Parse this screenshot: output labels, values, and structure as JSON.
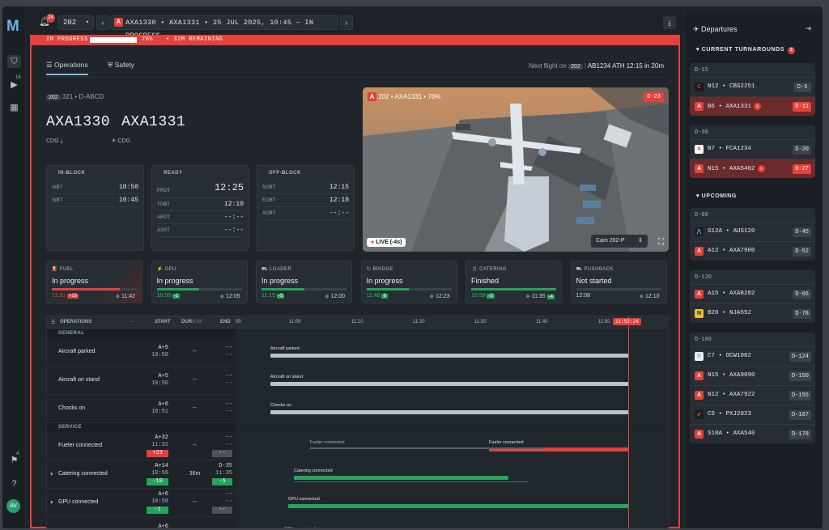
{
  "app": {
    "logo": "M",
    "rail_badge_camera": "16",
    "rail_badge_flag": "4",
    "avatar": "AV"
  },
  "topbar": {
    "bell_badge": "24",
    "stand_select": "202",
    "flight_selector": "AXA1330 • AXA1331 • 25 JUL 2025, 10:45 — IN PROGRESS"
  },
  "progress": {
    "status": "IN PROGRESS",
    "percent": 76,
    "percent_label": "76%",
    "remaining": "• 32M REMAINING"
  },
  "tabs": [
    {
      "label": "Operations",
      "active": true
    },
    {
      "label": "Safety",
      "active": false
    }
  ],
  "next_flight": {
    "prefix": "Next flight on",
    "stand": "202",
    "flight": "AB1234 ATH",
    "time": "12:15 in 20m"
  },
  "flight": {
    "stand": "202",
    "details": "321 • D-ABCD",
    "inbound": "AXA1330",
    "outbound": "AXA1331",
    "inbound_city": "CDG",
    "outbound_city": "CDG"
  },
  "time_cards": [
    {
      "title": "IN-BLOCK",
      "rows": [
        {
          "k": "AIBT",
          "v": "10:50"
        },
        {
          "k": "SIBT",
          "v": "10:45"
        }
      ]
    },
    {
      "title": "READY",
      "rows": [
        {
          "k": "PRDT",
          "v": "12:25"
        },
        {
          "k": "TOBT",
          "v": "12:10"
        },
        {
          "k": "ARDT",
          "v": "--:--"
        },
        {
          "k": "ASRT",
          "v": "--:--"
        }
      ]
    },
    {
      "title": "OFF-BLOCK",
      "rows": [
        {
          "k": "SOBT",
          "v": "12:15"
        },
        {
          "k": "EOBT",
          "v": "12:10"
        },
        {
          "k": "AOBT",
          "v": "--:--"
        }
      ]
    }
  ],
  "camera": {
    "title": "202 • AXA1331 • 76%",
    "badge": "D-23",
    "live": "LIVE (-4s)",
    "cam_select": "Cam 202-P"
  },
  "services": [
    {
      "name": "FUEL",
      "status": "In progress",
      "left": "11:31",
      "left_tag": "+23",
      "right": "11:42",
      "fill": 0.8,
      "color": "#e5413a"
    },
    {
      "name": "GPU",
      "status": "In progress",
      "left": "10:58",
      "left_tag": "-1",
      "right": "12:05",
      "fill": 0.5,
      "color": "#23a55a"
    },
    {
      "name": "LOADER",
      "status": "In progress",
      "left": "11:15",
      "left_tag": "-5",
      "right": "12:00",
      "fill": 0.5,
      "color": "#23a55a"
    },
    {
      "name": "BRIDGE",
      "status": "In progress",
      "left": "11:48",
      "left_tag": "8",
      "right": "12:23",
      "fill": 0.5,
      "color": "#23a55a"
    },
    {
      "name": "CATERING",
      "status": "Finished",
      "left": "10:59",
      "left_tag": "-2",
      "right": "11:35",
      "right_tag": "-4",
      "fill": 1.0,
      "color": "#23a55a"
    },
    {
      "name": "PUSHBACK",
      "status": "Not started",
      "left": "12:08",
      "right": "12:10",
      "fill": 0.0,
      "color": "#23a55a"
    }
  ],
  "ops_table": {
    "headers": {
      "title": "OPERATIONS",
      "menu": "···",
      "start": "START",
      "dur": "DUR",
      "sum": "SUM",
      "end": "END"
    },
    "ticks": [
      "00",
      "11:00",
      "11:10",
      "11:20",
      "11:30",
      "11:40",
      "11:50"
    ],
    "now": "11:52:24",
    "groups": [
      {
        "label": "GENERAL",
        "rows": [
          {
            "label": "Aircraft parked",
            "start": "A+5",
            "start2": "10:50",
            "dur": "--",
            "end": "--",
            "end2": "--",
            "bar_label": "Aircraft parked"
          },
          {
            "label": "Aircraft on stand",
            "start": "A+5",
            "start2": "10:50",
            "dur": "--",
            "end": "--",
            "end2": "--",
            "bar_label": "Aircraft on stand"
          },
          {
            "label": "Chocks on",
            "start": "A+6",
            "start2": "10:51",
            "dur": "--",
            "end": "--",
            "end2": "--",
            "bar_label": "Chocks on"
          }
        ]
      },
      {
        "label": "SERVICE",
        "rows": [
          {
            "label": "Fueler connected",
            "start": "A+32",
            "start2": "11:31",
            "start_tag": "+23",
            "dur": "--",
            "end": "--",
            "end2": "--",
            "end_tag": "--",
            "bar_label": "Fueler connected",
            "bar_label2": "Fueler connected"
          },
          {
            "label": "Catering connected",
            "start": "A+14",
            "start2": "10:59",
            "start_tag": "-10",
            "dur": "36m",
            "end": "D-35",
            "end2": "11:35",
            "end_tag": "-5",
            "bar_label": "Catering connected"
          },
          {
            "label": "GPU connected",
            "start": "A+6",
            "start2": "10:58",
            "start_tag": "-1",
            "dur": "--",
            "end": "--",
            "end2": "--",
            "end_tag": "--",
            "bar_label": "GPU connected"
          },
          {
            "label": "",
            "start": "A+6",
            "start2": "",
            "dur": "",
            "end": "",
            "end2": "",
            "bar_label": "ACU connected"
          }
        ]
      }
    ]
  },
  "sidebar": {
    "title": "Departures",
    "current_label": "CURRENT TURNAROUNDS",
    "current_count": "3",
    "upcoming_label": "UPCOMING",
    "groups": [
      {
        "header": "D-15",
        "flights": [
          {
            "code": "N12 • CBS2251",
            "delta": "D-5",
            "icon": "C",
            "icon_color": "#e0287b",
            "icon_bg": "#1b1b1b",
            "alert": false
          },
          {
            "code": "B6 • AXA1331",
            "badge": "2",
            "delta": "D-11",
            "icon": "A",
            "icon_color": "#fff",
            "icon_bg": "#e5413a",
            "alert": true
          }
        ]
      },
      {
        "header": "D-30",
        "flights": [
          {
            "code": "N7 • FCA1234",
            "delta": "D-20",
            "icon": "✕",
            "icon_color": "#e5413a",
            "icon_bg": "#fff",
            "alert": false
          },
          {
            "code": "N15 • AXA5402",
            "badge": "1",
            "delta": "D-27",
            "icon": "A",
            "icon_color": "#fff",
            "icon_bg": "#e5413a",
            "alert": true
          }
        ]
      },
      {
        "header": "D-60",
        "flights": [
          {
            "code": "S12A • AUS120",
            "delta": "D-45",
            "icon": "⋀",
            "icon_color": "#4fb3e8",
            "icon_bg": "#1a1f25",
            "alert": false
          },
          {
            "code": "A12 • AXA7900",
            "delta": "D-52",
            "icon": "A",
            "icon_color": "#fff",
            "icon_bg": "#e5413a",
            "alert": false
          }
        ]
      },
      {
        "header": "D-120",
        "flights": [
          {
            "code": "A15 • AXA8282",
            "delta": "D-66",
            "icon": "A",
            "icon_color": "#fff",
            "icon_bg": "#e5413a",
            "alert": false
          },
          {
            "code": "B20 • NJA552",
            "delta": "D-78",
            "icon": "N",
            "icon_color": "#1b1b1b",
            "icon_bg": "#f2c12e",
            "alert": false
          }
        ]
      },
      {
        "header": "D-180",
        "flights": [
          {
            "code": "C7 • OCW1002",
            "delta": "D-124",
            "icon": "V",
            "icon_color": "#6a9dd0",
            "icon_bg": "#e8eef4",
            "alert": false
          },
          {
            "code": "N15 • AXA9090",
            "delta": "D-150",
            "icon": "A",
            "icon_color": "#fff",
            "icon_bg": "#e5413a",
            "alert": false
          },
          {
            "code": "N12 • AXA7922",
            "delta": "D-155",
            "icon": "A",
            "icon_color": "#fff",
            "icon_bg": "#e5413a",
            "alert": false
          },
          {
            "code": "C9 • PXJ2023",
            "delta": "D-167",
            "icon": "➶",
            "icon_color": "#e0632e",
            "icon_bg": "#1a1f25",
            "alert": false
          },
          {
            "code": "S18A • AXA540",
            "delta": "D-178",
            "icon": "A",
            "icon_color": "#fff",
            "icon_bg": "#e5413a",
            "alert": false
          }
        ]
      }
    ]
  }
}
